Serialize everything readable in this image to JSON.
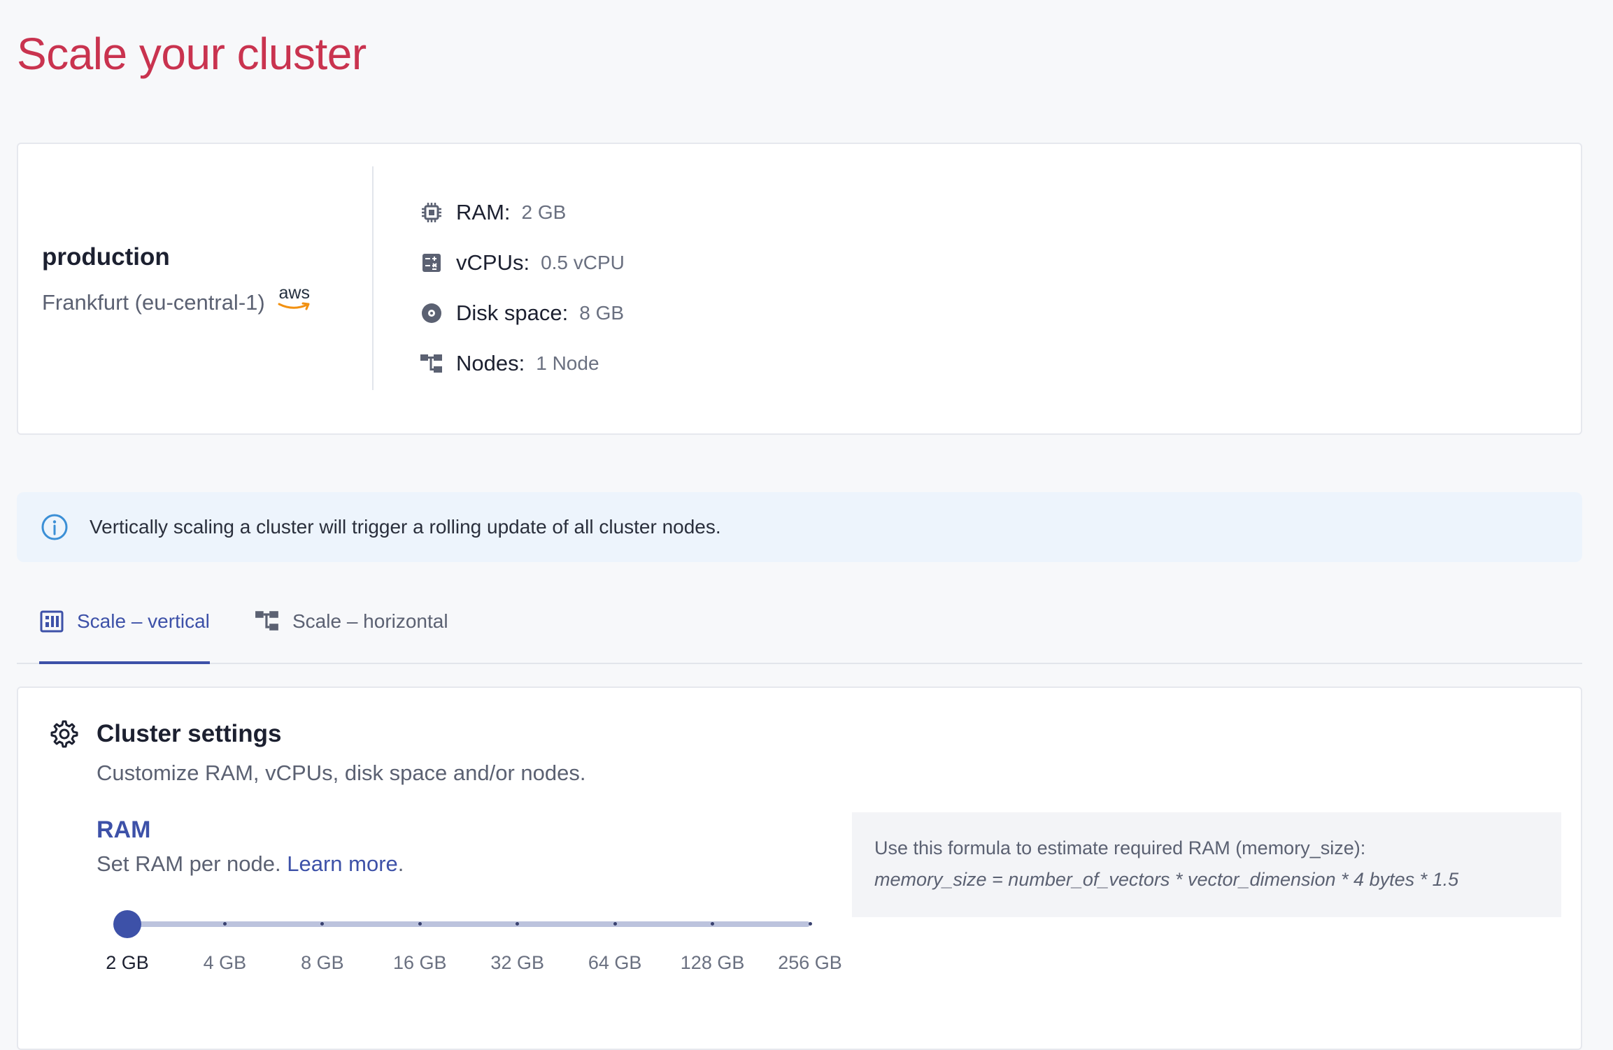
{
  "page": {
    "title": "Scale your cluster"
  },
  "cluster": {
    "name": "production",
    "region": "Frankfurt (eu-central-1)",
    "provider_logo": "aws",
    "specs": [
      {
        "icon": "cpu-chip-icon",
        "label": "RAM:",
        "value": "2 GB"
      },
      {
        "icon": "calculator-icon",
        "label": "vCPUs:",
        "value": "0.5 vCPU"
      },
      {
        "icon": "disk-icon",
        "label": "Disk space:",
        "value": "8 GB"
      },
      {
        "icon": "nodes-icon",
        "label": "Nodes:",
        "value": "1 Node"
      }
    ]
  },
  "alert": {
    "icon": "info-icon",
    "text": "Vertically scaling a cluster will trigger a rolling update of all cluster nodes."
  },
  "tabs": [
    {
      "label": "Scale – vertical",
      "icon": "vertical-scale-icon",
      "active": true
    },
    {
      "label": "Scale – horizontal",
      "icon": "nodes-icon",
      "active": false
    }
  ],
  "settings": {
    "icon": "gear-icon",
    "title": "Cluster settings",
    "subtitle": "Customize RAM, vCPUs, disk space and/or nodes.",
    "ram": {
      "heading": "RAM",
      "description": "Set RAM per node.",
      "learn_more": "Learn more",
      "description_end": ".",
      "options": [
        "2 GB",
        "4 GB",
        "8 GB",
        "16 GB",
        "32 GB",
        "64 GB",
        "128 GB",
        "256 GB"
      ],
      "selected_index": 0
    },
    "formula": {
      "intro": "Use this formula to estimate required RAM (memory_size):",
      "expression": "memory_size = number_of_vectors * vector_dimension * 4 bytes * 1.5"
    }
  },
  "colors": {
    "title": "#c9334f",
    "accent": "#3d51a8",
    "alert_bg": "#edf4fc",
    "info_icon": "#3b8fd6"
  }
}
